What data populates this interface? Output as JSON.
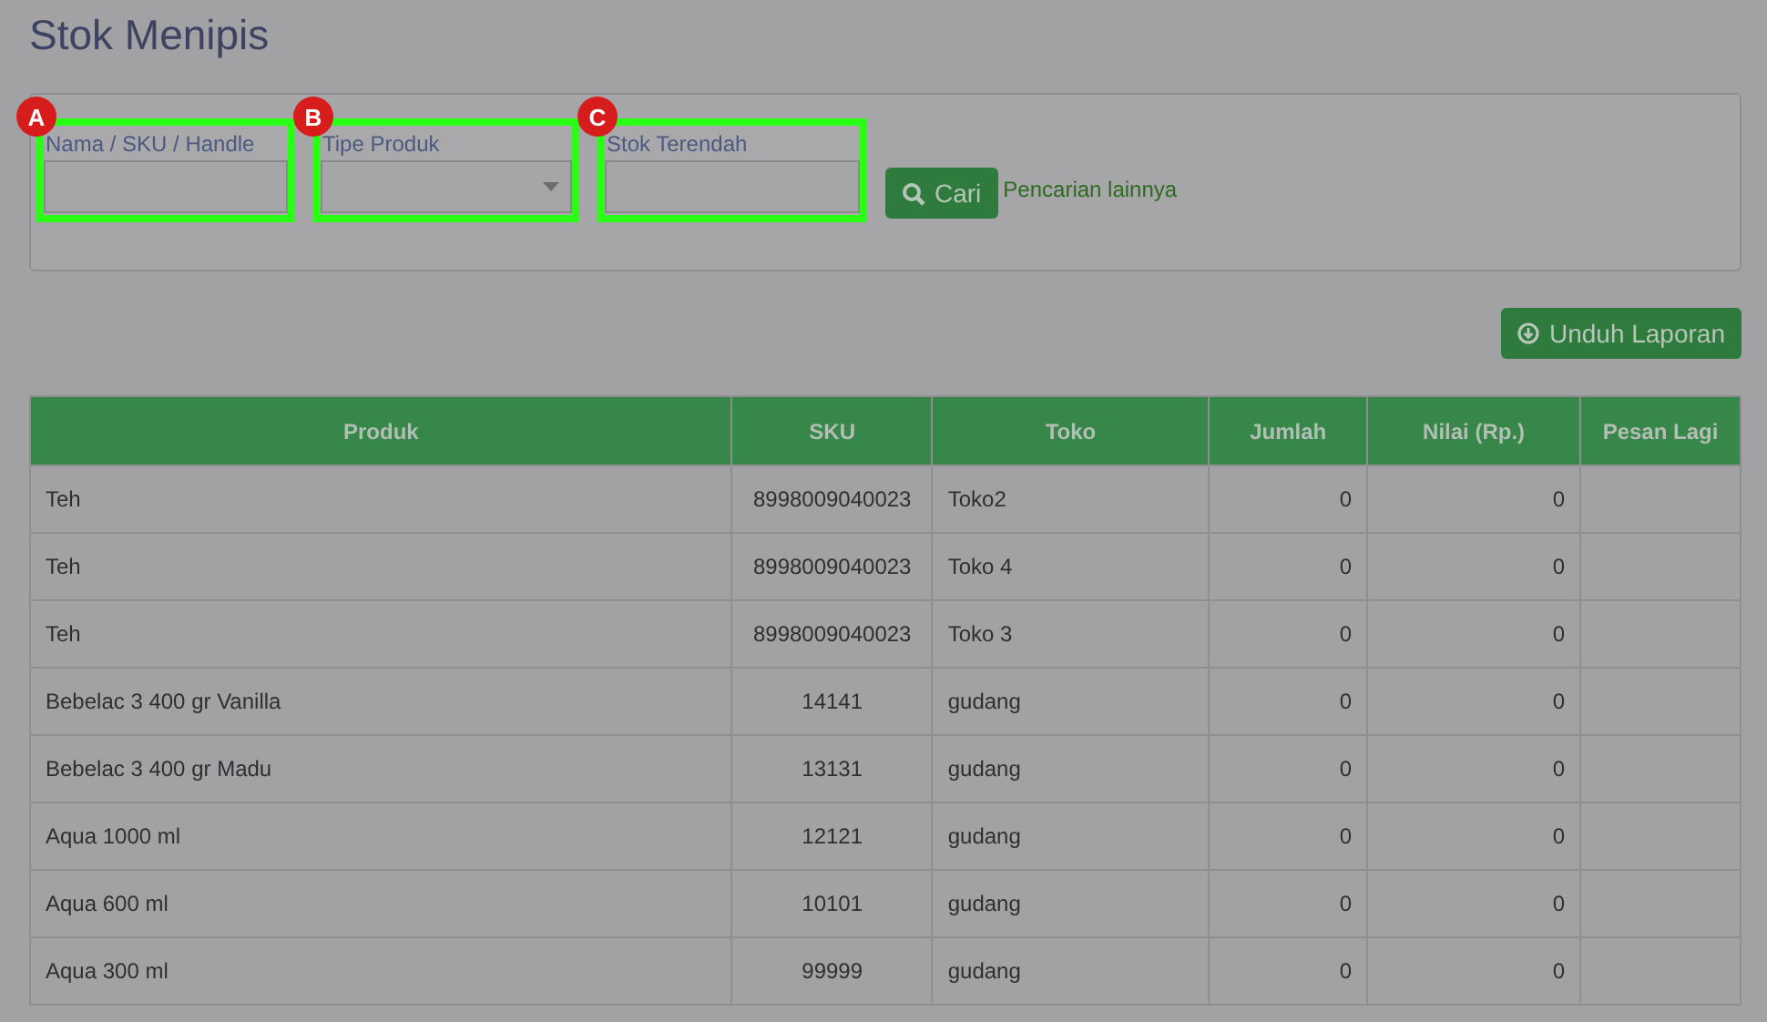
{
  "title": "Stok Menipis",
  "filters": [
    {
      "kind": "text",
      "label": "Nama / SKU / Handle",
      "badge": "A"
    },
    {
      "kind": "select",
      "label": "Tipe Produk",
      "badge": "B"
    },
    {
      "kind": "text",
      "label": "Stok Terendah",
      "badge": "C"
    }
  ],
  "search_button": "Cari",
  "more_link": "Pencarian lainnya",
  "download_button": "Unduh Laporan",
  "table": {
    "columns": [
      "Produk",
      "SKU",
      "Toko",
      "Jumlah",
      "Nilai (Rp.)",
      "Pesan Lagi"
    ],
    "rows": [
      [
        "Teh",
        "8998009040023",
        "Toko2",
        "0",
        "0",
        ""
      ],
      [
        "Teh",
        "8998009040023",
        "Toko 4",
        "0",
        "0",
        ""
      ],
      [
        "Teh",
        "8998009040023",
        "Toko 3",
        "0",
        "0",
        ""
      ],
      [
        "Bebelac 3 400 gr Vanilla",
        "14141",
        "gudang",
        "0",
        "0",
        ""
      ],
      [
        "Bebelac 3 400 gr Madu",
        "13131",
        "gudang",
        "0",
        "0",
        ""
      ],
      [
        "Aqua 1000 ml",
        "12121",
        "gudang",
        "0",
        "0",
        ""
      ],
      [
        "Aqua 600 ml",
        "10101",
        "gudang",
        "0",
        "0",
        ""
      ],
      [
        "Aqua 300 ml",
        "99999",
        "gudang",
        "0",
        "0",
        ""
      ]
    ]
  }
}
